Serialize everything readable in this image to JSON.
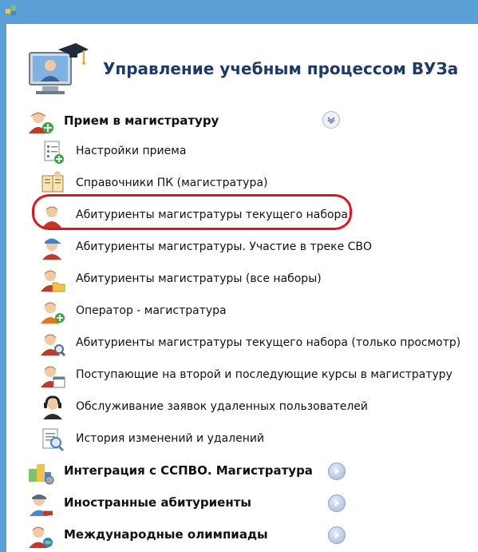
{
  "app": {
    "title": "Управление учебным процессом ВУЗа"
  },
  "groups": [
    {
      "label": "Прием в магистратуру",
      "expanded": true,
      "items": [
        {
          "label": "Настройки приема",
          "icon": "settings-list-icon"
        },
        {
          "label": "Справочники ПК (магистратура)",
          "icon": "reference-books-icon"
        },
        {
          "label": "Абитуриенты магистратуры текущего набора",
          "icon": "applicant-icon",
          "highlighted": true
        },
        {
          "label": "Абитуриенты магистратуры. Участие в треке СВО",
          "icon": "applicant-cap-icon"
        },
        {
          "label": "Абитуриенты магистратуры (все наборы)",
          "icon": "applicant-folder-icon"
        },
        {
          "label": "Оператор - магистратура",
          "icon": "operator-add-icon"
        },
        {
          "label": "Абитуриенты магистратуры текущего набора (только просмотр)",
          "icon": "applicant-search-icon"
        },
        {
          "label": "Поступающие на второй и последующие курсы в магистратуру",
          "icon": "applicant-calendar-icon"
        },
        {
          "label": "Обслуживание заявок удаленных пользователей",
          "icon": "headset-user-icon"
        },
        {
          "label": "История изменений и удалений",
          "icon": "history-search-icon"
        }
      ]
    },
    {
      "label": "Интеграция с ССПВО. Магистратура",
      "expanded": false,
      "icon": "integration-icon"
    },
    {
      "label": "Иностранные абитуриенты",
      "expanded": false,
      "icon": "foreign-applicant-icon"
    },
    {
      "label": "Международные олимпиады",
      "expanded": false,
      "icon": "olympiad-icon"
    }
  ],
  "colors": {
    "window_frame": "#5aa0d6",
    "title_text": "#1f3a68",
    "highlight": "#e0141e"
  }
}
